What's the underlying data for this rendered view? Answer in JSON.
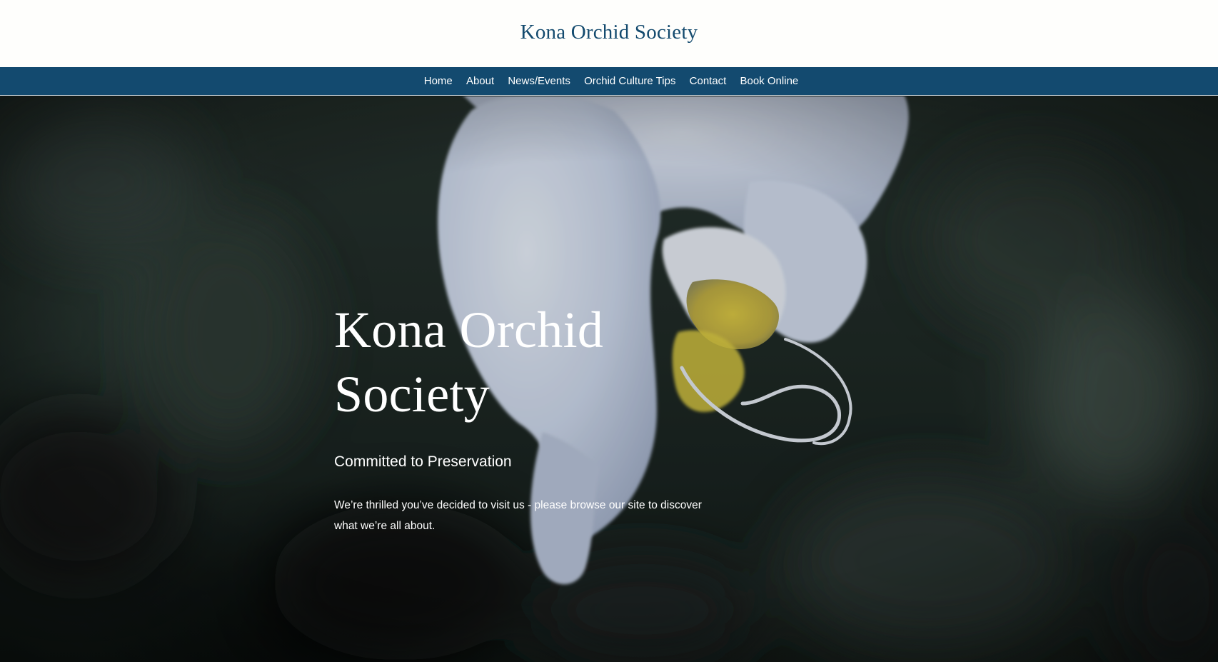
{
  "header": {
    "site_title": "Kona Orchid Society"
  },
  "nav": {
    "items": [
      {
        "label": "Home"
      },
      {
        "label": "About"
      },
      {
        "label": "News/Events"
      },
      {
        "label": "Orchid Culture Tips"
      },
      {
        "label": "Contact"
      },
      {
        "label": "Book Online"
      }
    ]
  },
  "hero": {
    "title_line1": "Kona Orchid",
    "title_line2": "Society",
    "subtitle": "Committed to Preservation",
    "text": "We’re thrilled you’ve decided to visit us - please browse our site to discover what we’re all about.",
    "image": "white-orchid-flower-photo"
  },
  "colors": {
    "header_bg": "#fefefc",
    "brand_blue": "#134a6f",
    "hero_text": "#ffffff"
  }
}
